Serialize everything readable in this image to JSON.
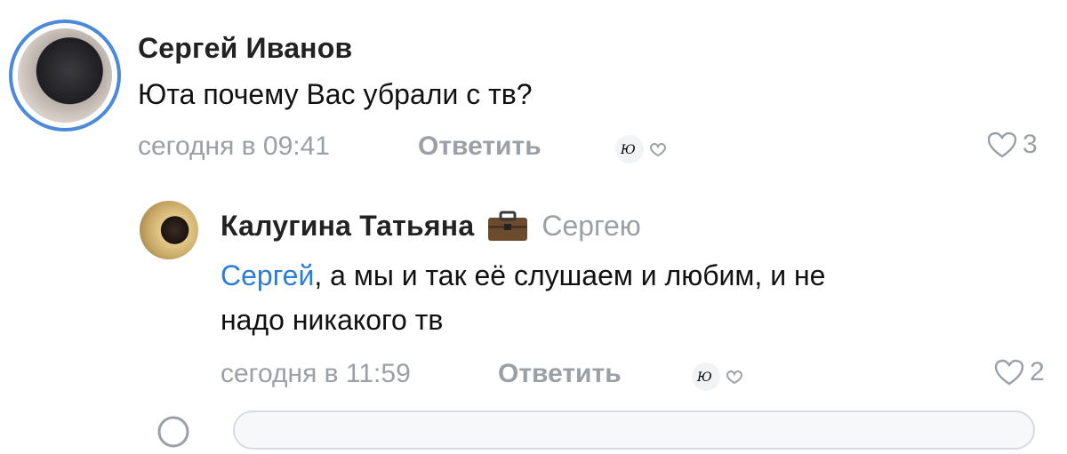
{
  "comments": [
    {
      "author": "Сергей Иванов",
      "text": "Юта почему Вас убрали с тв?",
      "time": "сегодня в 09:41",
      "reply_label": "Ответить",
      "likes": "3"
    },
    {
      "author": "Калугина Татьяна",
      "addressee": "Сергею",
      "mention": "Сергей",
      "text_line1": ", а мы и так её слушаем и любим, и не",
      "text_line2": "надо никакого тв",
      "time": "сегодня в 11:59",
      "reply_label": "Ответить",
      "likes": "2"
    }
  ],
  "author_badge_text": "Ю",
  "colors": {
    "link": "#2a7fd4",
    "meta": "#9aa0a6",
    "ring": "#4a89dc"
  }
}
